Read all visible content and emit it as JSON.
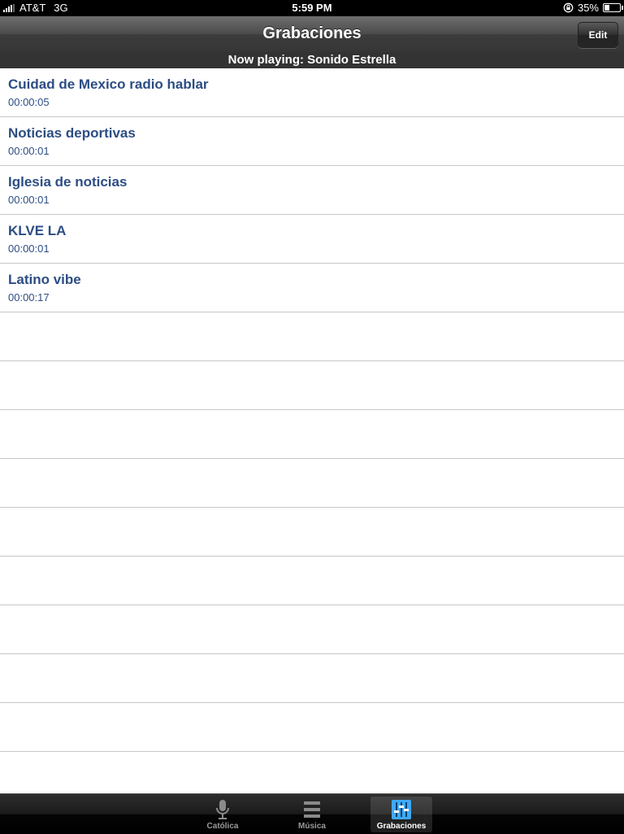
{
  "status_bar": {
    "carrier": "AT&T",
    "network": "3G",
    "time": "5:59 PM",
    "battery": "35%",
    "battery_level": 0.35
  },
  "nav": {
    "title": "Grabaciones",
    "edit_label": "Edit"
  },
  "now_playing": "Now playing: Sonido Estrella",
  "recordings": [
    {
      "title": "Cuidad de Mexico radio hablar",
      "duration": "00:00:05"
    },
    {
      "title": "Noticias deportivas",
      "duration": "00:00:01"
    },
    {
      "title": "Iglesia de noticias",
      "duration": "00:00:01"
    },
    {
      "title": "KLVE LA",
      "duration": "00:00:01"
    },
    {
      "title": "Latino vibe",
      "duration": "00:00:17"
    },
    {
      "title": "",
      "duration": ""
    },
    {
      "title": "",
      "duration": ""
    },
    {
      "title": "",
      "duration": ""
    },
    {
      "title": "",
      "duration": ""
    },
    {
      "title": "",
      "duration": ""
    },
    {
      "title": "",
      "duration": ""
    },
    {
      "title": "",
      "duration": ""
    },
    {
      "title": "",
      "duration": ""
    },
    {
      "title": "",
      "duration": ""
    },
    {
      "title": "",
      "duration": ""
    }
  ],
  "tabs": [
    {
      "label": "Católica",
      "icon": "microphone-icon",
      "active": false
    },
    {
      "label": "Música",
      "icon": "list-icon",
      "active": false
    },
    {
      "label": "Grabaciones",
      "icon": "equalizer-icon",
      "active": true
    }
  ],
  "colors": {
    "row_text": "#2c4d83",
    "active_tab_icon": "#3fa9f5"
  }
}
